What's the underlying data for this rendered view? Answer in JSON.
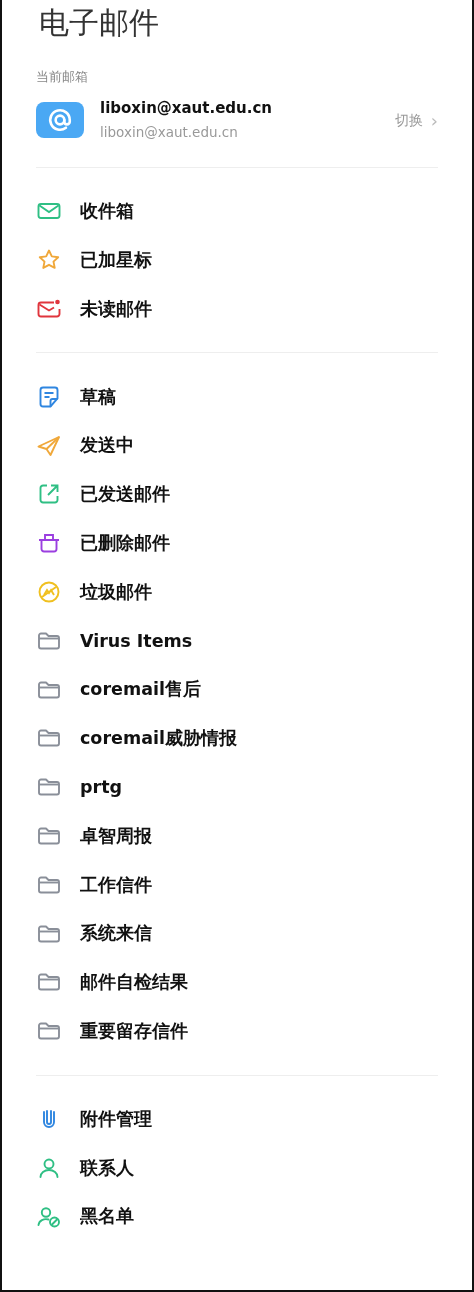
{
  "title": "电子邮件",
  "current_mailbox": {
    "label": "当前邮箱",
    "name": "liboxin@xaut.edu.cn",
    "address": "liboxin@xaut.edu.cn",
    "switch": "切换",
    "chevron": "›"
  },
  "groups": [
    {
      "items": [
        {
          "kind": "inbox",
          "label": "收件箱"
        },
        {
          "kind": "starred",
          "label": "已加星标"
        },
        {
          "kind": "unread",
          "label": "未读邮件"
        }
      ]
    },
    {
      "items": [
        {
          "kind": "drafts",
          "label": "草稿"
        },
        {
          "kind": "sending",
          "label": "发送中"
        },
        {
          "kind": "sent",
          "label": "已发送邮件"
        },
        {
          "kind": "deleted",
          "label": "已删除邮件"
        },
        {
          "kind": "spam",
          "label": "垃圾邮件"
        },
        {
          "kind": "folder",
          "label": "Virus Items"
        },
        {
          "kind": "folder",
          "label": "coremail售后"
        },
        {
          "kind": "folder",
          "label": "coremail威胁情报"
        },
        {
          "kind": "folder",
          "label": "prtg"
        },
        {
          "kind": "folder",
          "label": "卓智周报"
        },
        {
          "kind": "folder",
          "label": "工作信件"
        },
        {
          "kind": "folder",
          "label": "系统来信"
        },
        {
          "kind": "folder",
          "label": "邮件自检结果"
        },
        {
          "kind": "folder",
          "label": "重要留存信件"
        }
      ]
    },
    {
      "items": [
        {
          "kind": "attachments",
          "label": "附件管理"
        },
        {
          "kind": "contacts",
          "label": "联系人"
        },
        {
          "kind": "blacklist",
          "label": "黑名单"
        }
      ]
    }
  ]
}
